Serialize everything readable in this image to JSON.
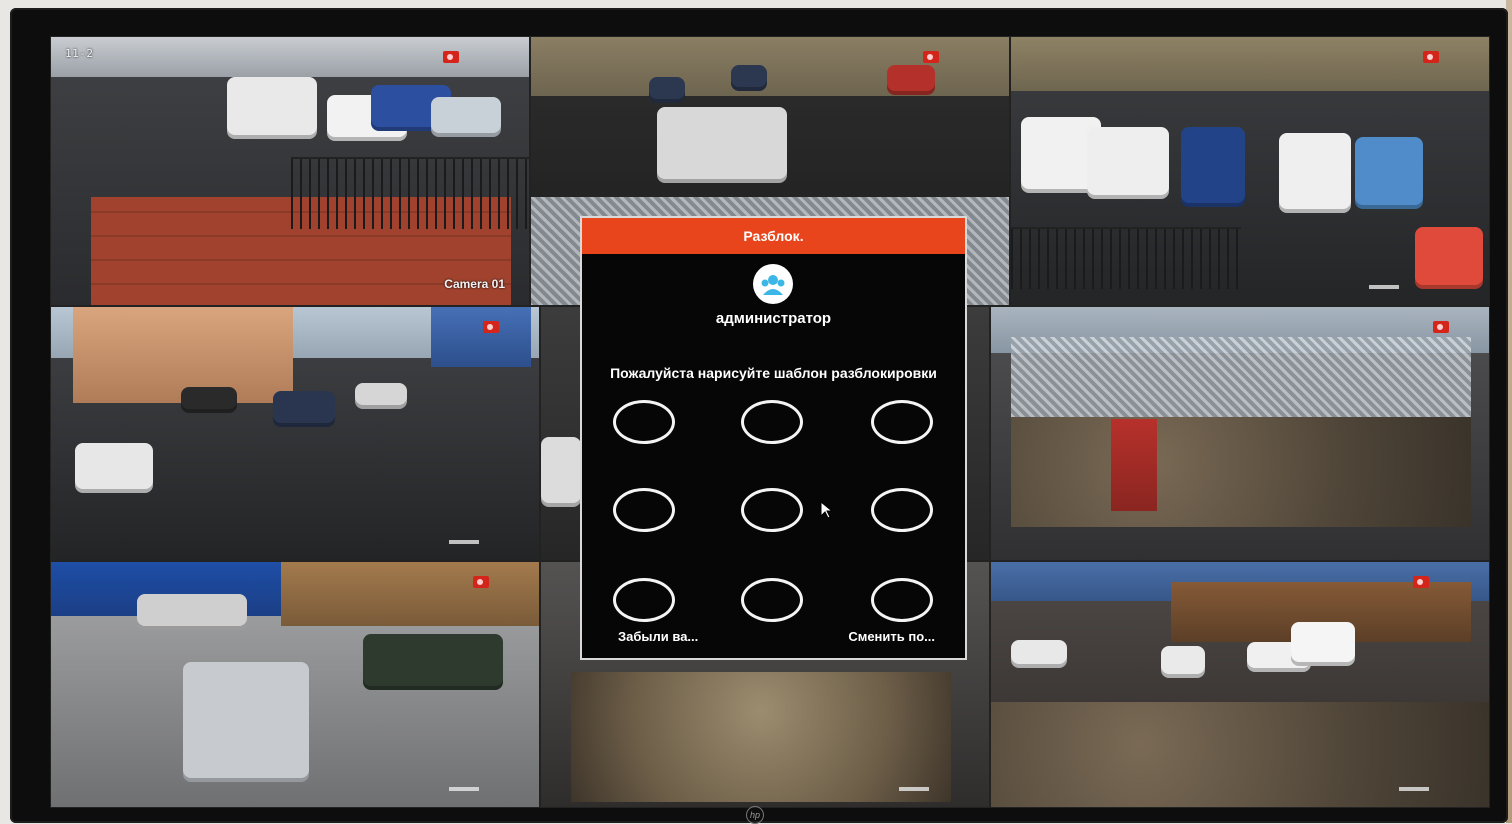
{
  "cameras": [
    {
      "id": "cam1",
      "timestamp": "11-2",
      "name": "Camera 01",
      "recording": true
    },
    {
      "id": "cam2",
      "timestamp": "",
      "name": "",
      "recording": true
    },
    {
      "id": "cam3",
      "timestamp": "",
      "name": "",
      "recording": true
    },
    {
      "id": "cam4",
      "timestamp": "",
      "name": "",
      "recording": true
    },
    {
      "id": "cam5",
      "timestamp": "",
      "name": "",
      "recording": false
    },
    {
      "id": "cam6",
      "timestamp": "",
      "name": "",
      "recording": true
    },
    {
      "id": "cam7",
      "timestamp": "",
      "name": "",
      "recording": true
    },
    {
      "id": "cam8",
      "timestamp": "",
      "name": "",
      "recording": false
    },
    {
      "id": "cam9",
      "timestamp": "",
      "name": "",
      "recording": true
    }
  ],
  "dialog": {
    "title": "Разблок.",
    "username": "администратор",
    "instruction": "Пожалуйста нарисуйте шаблон разблокировки",
    "pattern_dots": 9,
    "forgot_link": "Забыли ва...",
    "change_link": "Сменить по..."
  },
  "colors": {
    "header": "#e8451d",
    "dialog_bg": "#060606",
    "rec": "#d4251b"
  },
  "icons": {
    "user": "user-avatar-icon",
    "rec": "recording-icon",
    "cursor": "mouse-pointer-icon"
  }
}
